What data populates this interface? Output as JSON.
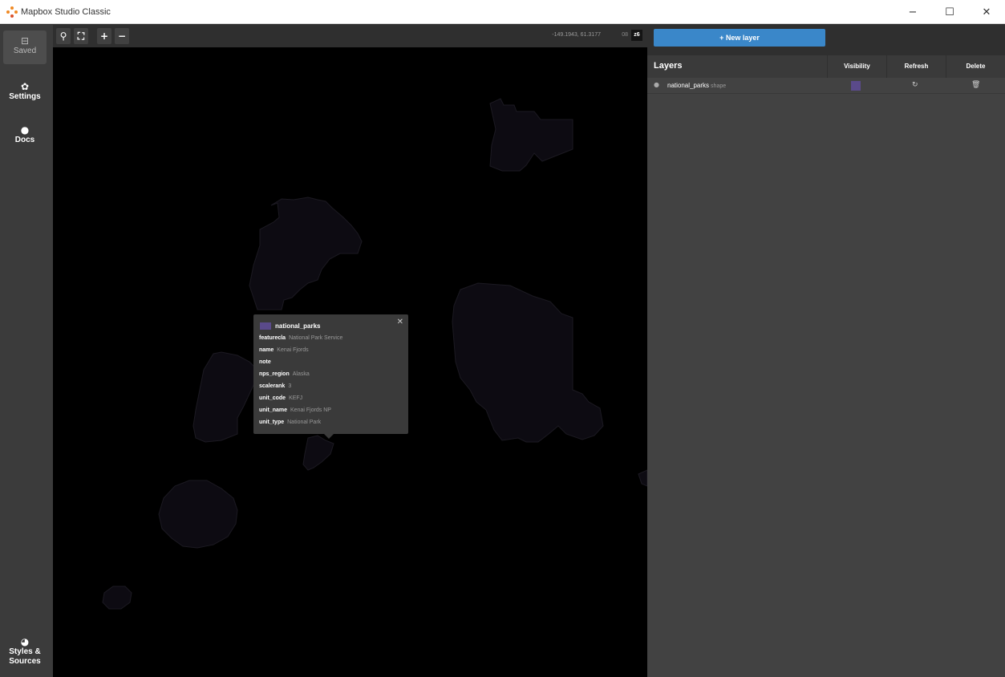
{
  "window": {
    "title": "Mapbox Studio Classic",
    "minimize_glyph": "−",
    "maximize_glyph": "☐",
    "close_glyph": "✕"
  },
  "sidebar": {
    "saved": {
      "label": "Saved",
      "icon": "save-icon",
      "glyph": "⊟"
    },
    "settings": {
      "label": "Settings",
      "icon": "gear-icon",
      "glyph": "✿"
    },
    "docs": {
      "label": "Docs",
      "icon": "info-icon",
      "glyph": "●"
    },
    "styles": {
      "label_line1": "Styles &",
      "label_line2": "Sources",
      "icon": "palette-icon",
      "glyph": "◕"
    }
  },
  "map_toolbar": {
    "search_glyph": "⚲",
    "fullscreen_glyph": "⛶",
    "zoom_in_glyph": "+",
    "zoom_out_glyph": "−",
    "coordinates": "-149.1943, 61.3177",
    "zoom_label": "08",
    "zoom_value": "z6"
  },
  "popup": {
    "layer_name": "national_parks",
    "close_glyph": "✕",
    "fields": [
      {
        "key": "featurecla",
        "value": "National Park Service"
      },
      {
        "key": "name",
        "value": "Kenai Fjords"
      },
      {
        "key": "note",
        "value": ""
      },
      {
        "key": "nps_region",
        "value": "Alaska"
      },
      {
        "key": "scalerank",
        "value": "3"
      },
      {
        "key": "unit_code",
        "value": "KEFJ"
      },
      {
        "key": "unit_name",
        "value": "Kenai Fjords NP"
      },
      {
        "key": "unit_type",
        "value": "National Park"
      }
    ]
  },
  "panel": {
    "new_layer_label": "+ New layer",
    "header": {
      "title": "Layers",
      "visibility": "Visibility",
      "refresh": "Refresh",
      "delete": "Delete"
    },
    "layers": [
      {
        "name": "national_parks",
        "type": "shape",
        "color": "#5a4a8a",
        "refresh_glyph": "↻",
        "delete_glyph": "🗑"
      }
    ]
  },
  "colors": {
    "accent": "#3a87c9",
    "layer_fill": "#5a4a8a",
    "map_bg": "#000000"
  }
}
